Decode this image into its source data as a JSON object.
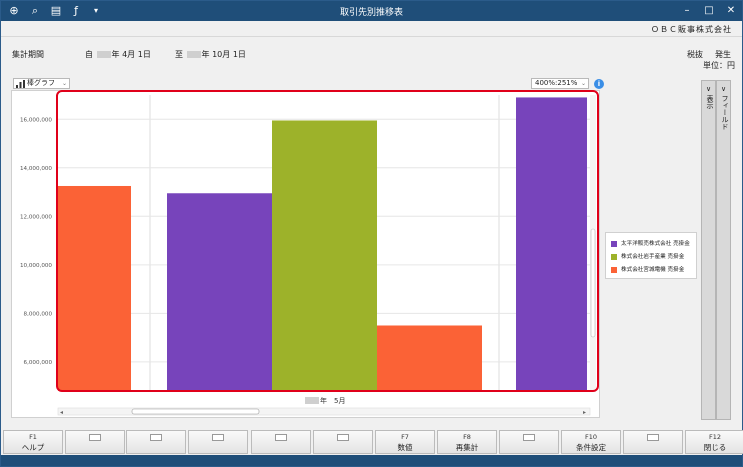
{
  "window": {
    "title": "取引先別推移表",
    "company": "ＯＢＣ販事株式会社"
  },
  "toolbar_icons": [
    "zoom-in-icon",
    "search-icon",
    "print-icon",
    "fx-icon",
    "dropdown-arrow-icon"
  ],
  "header": {
    "period_label": "集計期間",
    "from_prefix": "自",
    "from_year_suffix": "年",
    "from_month_day": "4月 1日",
    "to_prefix": "至",
    "to_year_suffix": "年",
    "to_month_day": "10月 1日",
    "tax_label": "税抜",
    "occurrence_label": "発生",
    "unit_label": "単位：円"
  },
  "controls": {
    "graph_type": "棒グラフ",
    "zoom": "400%:251%"
  },
  "side_tabs": [
    {
      "chevron": "∨",
      "label": "表示"
    },
    {
      "chevron": "∨",
      "label": "フィールド"
    }
  ],
  "chart_data": {
    "type": "bar",
    "title": "",
    "xlabel": "",
    "ylabel": "",
    "ylim": [
      4800000,
      17000000
    ],
    "yticks": [
      "6,000,000",
      "8,000,000",
      "10,000,000",
      "12,000,000",
      "14,000,000",
      "16,000,000"
    ],
    "category_label_year_suffix": "年",
    "category_label_month": "5月",
    "series": [
      {
        "name": "太平洋販売株式会社 売掛金",
        "color": "#7744bb"
      },
      {
        "name": "株式会社岩手産業 売掛金",
        "color": "#9db22a"
      },
      {
        "name": "株式会社宮城電機 売掛金",
        "color": "#fb6236"
      }
    ],
    "bars": [
      {
        "series": 2,
        "value": 13250000
      },
      {
        "series": 0,
        "value": 12950000
      },
      {
        "series": 1,
        "value": 15950000
      },
      {
        "series": 2,
        "value": 7500000
      },
      {
        "series": 0,
        "value": 16900000
      }
    ]
  },
  "function_keys": [
    {
      "num": "F1",
      "label": "ヘルプ"
    },
    {
      "num": "",
      "label": ""
    },
    {
      "num": "",
      "label": ""
    },
    {
      "num": "",
      "label": ""
    },
    {
      "num": "",
      "label": ""
    },
    {
      "num": "",
      "label": ""
    },
    {
      "num": "F7",
      "label": "数値"
    },
    {
      "num": "F8",
      "label": "再集計"
    },
    {
      "num": "",
      "label": ""
    },
    {
      "num": "F10",
      "label": "条件設定"
    },
    {
      "num": "",
      "label": ""
    },
    {
      "num": "F12",
      "label": "閉じる"
    }
  ]
}
